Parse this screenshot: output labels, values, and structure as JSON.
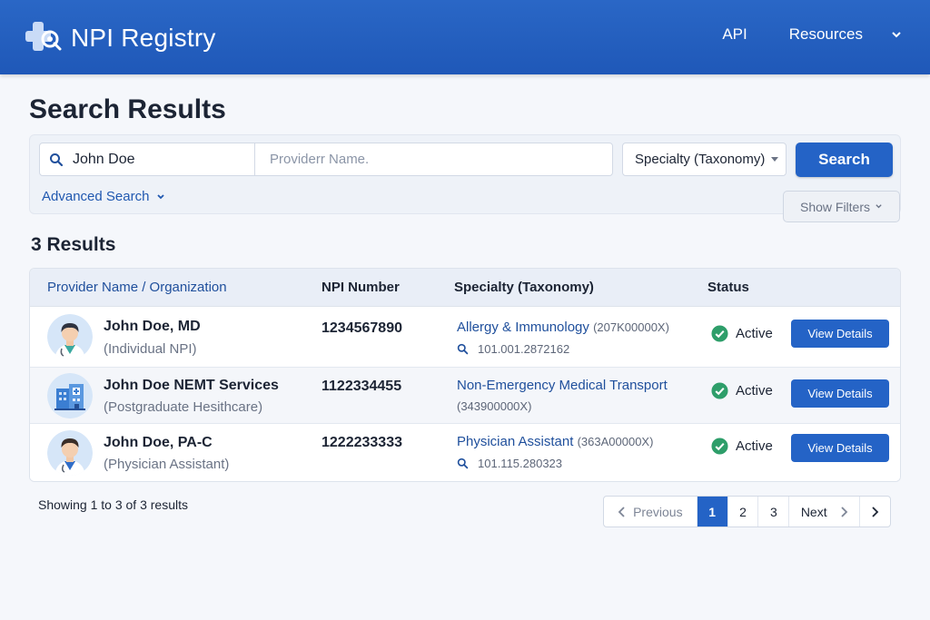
{
  "header": {
    "title": "NPI Registry",
    "nav": {
      "api": "API",
      "resources": "Resources"
    }
  },
  "page": {
    "title": "Search Results"
  },
  "search": {
    "name_value": "John Doe",
    "provider_placeholder": "Providerr Name.",
    "specialty_select": "Specialty (Taxonomy)",
    "search_button": "Search",
    "advanced": "Advanced Search",
    "show_filters": "Show Filters"
  },
  "results": {
    "count_label": "3 Results"
  },
  "table": {
    "columns": [
      "Provider Name / Organization",
      "NPI Number",
      "Specialty (Taxonomy)",
      "Status"
    ],
    "rows": [
      {
        "name": "John Doe, MD",
        "sub": "(Individual NPI)",
        "npi": "1234567890",
        "specialty": "Allergy & Immunology",
        "code": "(207K00000X)",
        "license": "101.001.2872162",
        "status": "Active",
        "action": "View Details"
      },
      {
        "name": "John Doe NEMT Services",
        "sub": "(Postgraduate Hesithcare)",
        "npi": "1122334455",
        "specialty": "Non-Emergency Medical Transport",
        "code": "(343900000X)",
        "license": "",
        "status": "Active",
        "action": "View Details"
      },
      {
        "name": "John Doe, PA-C",
        "sub": "(Physician Assistant)",
        "npi": "1222233333",
        "specialty": "Physician Assistant",
        "code": "(363A00000X)",
        "license": "101.115.280323",
        "status": "Active",
        "action": "View Details"
      }
    ]
  },
  "pagination": {
    "summary": "Showing 1 to 3 of 3 results",
    "previous": "Previous",
    "pages": [
      "1",
      "2",
      "3"
    ],
    "current": "1",
    "next": "Next"
  },
  "colors": {
    "brand": "#2463c6",
    "header": "#1f58b8",
    "active_status": "#2e9e6a"
  }
}
